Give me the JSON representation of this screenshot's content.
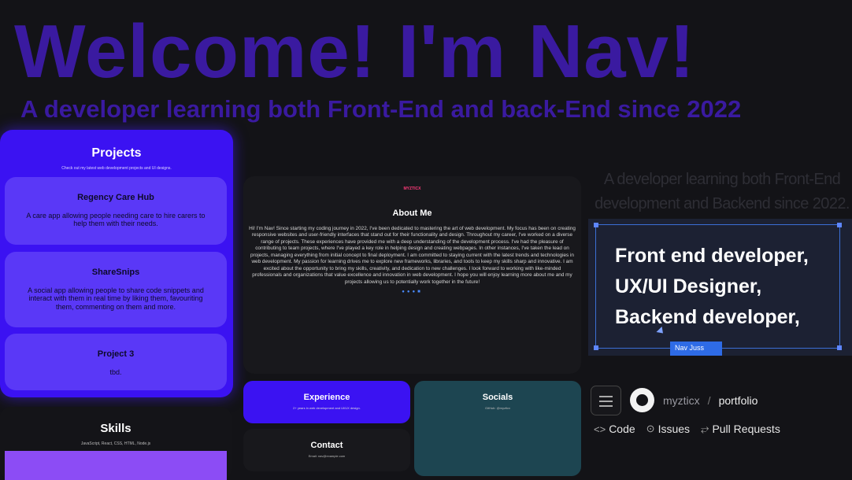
{
  "hero": {
    "title": "Welcome! I'm Nav!",
    "subtitle": "A developer learning both Front-End and back-End since 2022"
  },
  "projects": {
    "title": "Projects",
    "description": "Check out my latest web development projects and UI designs.",
    "items": [
      {
        "title": "Regency Care Hub",
        "description": "A care app allowing people needing care to hire carers to help them with their needs."
      },
      {
        "title": "ShareSnips",
        "description": "A social app allowing people to share code snippets and interact with them in real time by liking them, favouriting them, commenting on them and more."
      },
      {
        "title": "Project 3",
        "description": "tbd."
      }
    ]
  },
  "skills": {
    "title": "Skills",
    "list": "JavaScript, React, CSS, HTML, Node.js"
  },
  "about": {
    "logo": "MYZTICX",
    "title": "About Me",
    "text": "Hi! I'm Nav! Since starting my coding journey in 2022, I've been dedicated to mastering the art of web development. My focus has been on creating responsive websites and user-friendly interfaces that stand out for their functionality and design. Throughout my career, I've worked on a diverse range of projects. These experiences have provided me with a deep understanding of the development process. I've had the pleasure of contributing to team projects, where I've played a key role in helping design and creating webpages. In other instances, I've taken the lead on projects, managing everything from initial concept to final deployment. I am committed to staying current with the latest trends and technologies in web development. My passion for learning drives me to explore new frameworks, libraries, and tools to keep my skills sharp and innovative. I am excited about the opportunity to bring my skills, creativity, and dedication to new challenges. I look forward to working with like-minded professionals and organizations that value excellence and innovation in web development. I hope you will enjoy learning more about me and my projects allowing us to potentially work together in the future!",
    "icons": [
      "github-icon",
      "twitter-icon",
      "instagram-icon",
      "youtube-icon"
    ]
  },
  "experience": {
    "title": "Experience",
    "text": "2+ years in web development and UI/UX design."
  },
  "contact": {
    "title": "Contact",
    "text": "Email: nav@example.com"
  },
  "socials": {
    "title": "Socials",
    "text": "GitHub: @myzticx"
  },
  "tagline_ghost": "A developer learning both Front-End development and Backend since 2022.",
  "roles": {
    "lines": [
      "Front end developer,",
      "UX/UI Designer,",
      "Backend developer,"
    ],
    "cursor_tag": "Nav Juss"
  },
  "github": {
    "owner": "myzticx",
    "separator": "/",
    "repo": "portfolio",
    "nav": [
      {
        "icon": "code-icon",
        "glyph": "<>",
        "label": "Code"
      },
      {
        "icon": "issues-icon",
        "glyph": "⊙",
        "label": "Issues"
      },
      {
        "icon": "pull-request-icon",
        "glyph": "⥂",
        "label": "Pull Requests"
      }
    ]
  },
  "colors": {
    "accent": "#3b12f2",
    "hero_text": "#3a1aa0",
    "card_purple": "#5a38f7",
    "socials_teal": "#1d4551",
    "skills_bar": "#8c4cf5"
  }
}
